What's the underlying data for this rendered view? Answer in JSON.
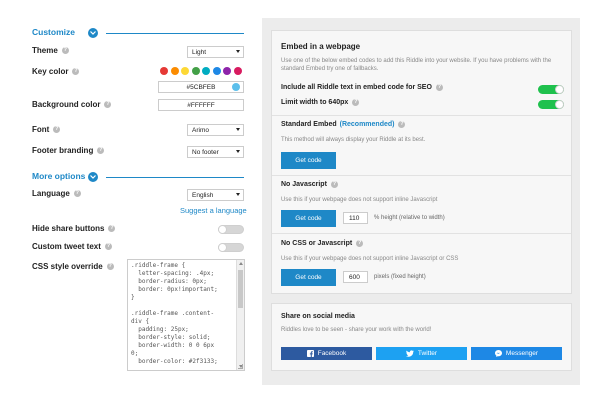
{
  "customize": {
    "heading": "Customize",
    "theme": {
      "label": "Theme",
      "value": "Light"
    },
    "key_color": {
      "label": "Key color",
      "swatches": [
        "#e53935",
        "#fb8c00",
        "#fdd835",
        "#43a047",
        "#00acc1",
        "#1e88e5",
        "#8e24aa",
        "#d81b60"
      ],
      "value": "#5CBFEB",
      "accent": "#5CBFEB"
    },
    "background_color": {
      "label": "Background color",
      "value": "#FFFFFF"
    },
    "font": {
      "label": "Font",
      "value": "Arimo"
    },
    "footer_branding": {
      "label": "Footer branding",
      "value": "No footer"
    }
  },
  "more_options": {
    "heading": "More options",
    "language": {
      "label": "Language",
      "value": "English",
      "suggest_link": "Suggest a language"
    },
    "hide_share": {
      "label": "Hide share buttons",
      "on": false
    },
    "custom_tweet": {
      "label": "Custom tweet text",
      "on": false
    },
    "css_override": {
      "label": "CSS style override",
      "code": ".riddle-frame {\n  letter-spacing: .4px;\n  border-radius: 0px;\n  border: 0px!important;\n}\n\n.riddle-frame .content-\ndiv {\n  padding: 25px;\n  border-style: solid;\n  border-width: 0 0 6px\n0;\n  border-color: #2f3133;"
    }
  },
  "embed": {
    "title": "Embed in a webpage",
    "description": "Use one of the below embed codes to add this Riddle into your website. If you have problems with the standard Embed try one of fallbacks.",
    "seo": {
      "label": "Include all Riddle text in embed code for SEO",
      "on": true
    },
    "limit_width": {
      "label": "Limit width to 640px",
      "on": true
    },
    "standard": {
      "label": "Standard Embed",
      "recommended": "(Recommended)",
      "description": "This method will always display your Riddle at its best.",
      "button": "Get code"
    },
    "no_js": {
      "label": "No Javascript",
      "description": "Use this if your webpage does not support inline Javascript",
      "button": "Get code",
      "value": "110",
      "suffix": "% height (relative to width)"
    },
    "no_css_js": {
      "label": "No CSS or Javascript",
      "description": "Use this if your webpage does not support inline Javascript or CSS",
      "button": "Get code",
      "value": "600",
      "suffix": "pixels (fixed height)"
    }
  },
  "share": {
    "title": "Share on social media",
    "description": "Riddles love to be seen - share your work with the world!",
    "facebook": {
      "label": "Facebook",
      "color": "#2d5aa0"
    },
    "twitter": {
      "label": "Twitter",
      "color": "#1da1f2"
    },
    "messenger": {
      "label": "Messenger",
      "color": "#1e88e5"
    }
  }
}
